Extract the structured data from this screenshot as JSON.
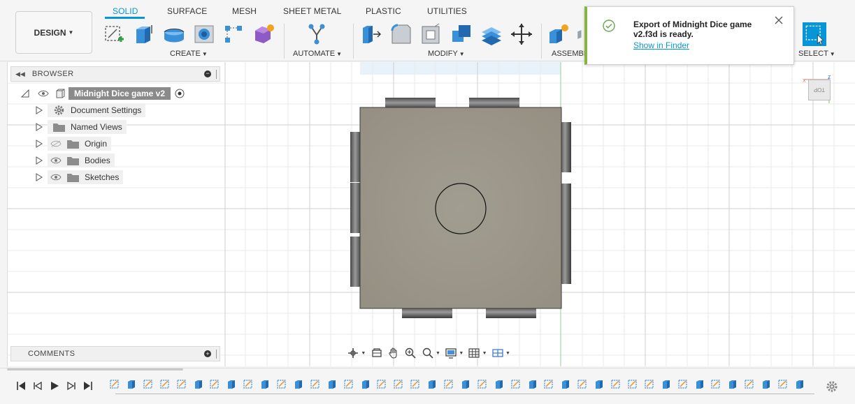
{
  "workspace": {
    "label": "DESIGN"
  },
  "tabs": [
    {
      "label": "SOLID",
      "active": true
    },
    {
      "label": "SURFACE",
      "active": false
    },
    {
      "label": "MESH",
      "active": false
    },
    {
      "label": "SHEET METAL",
      "active": false
    },
    {
      "label": "PLASTIC",
      "active": false
    },
    {
      "label": "UTILITIES",
      "active": false
    }
  ],
  "groups": {
    "create": "CREATE",
    "automate": "AUTOMATE",
    "modify": "MODIFY",
    "assemble": "ASSEMBL",
    "select": "SELECT"
  },
  "icons": {
    "create": [
      "create-sketch-icon",
      "extrude-icon",
      "revolve-icon",
      "hole-icon",
      "pattern-icon",
      "form-icon"
    ],
    "automate": [
      "automate-icon"
    ],
    "modify": [
      "press-pull-icon",
      "fillet-icon",
      "shell-icon",
      "combine-icon",
      "offset-face-icon",
      "move-icon"
    ],
    "assemble": [
      "new-component-icon"
    ],
    "select": "select-icon"
  },
  "browser": {
    "title": "BROWSER",
    "root": "Midnight Dice game v2",
    "items": [
      {
        "label": "Document Settings",
        "icon": "gear-icon"
      },
      {
        "label": "Named Views",
        "icon": "folder-icon"
      },
      {
        "label": "Origin",
        "icon": "folder-icon",
        "visible": false
      },
      {
        "label": "Bodies",
        "icon": "folder-icon",
        "visible": true
      },
      {
        "label": "Sketches",
        "icon": "folder-icon",
        "visible": true
      }
    ]
  },
  "comments": {
    "title": "COMMENTS"
  },
  "viewcube": {
    "face": "TOP",
    "axis_x": "X",
    "axis_z": "Z"
  },
  "notification": {
    "message": "Export of Midnight Dice game v2.f3d is ready.",
    "link": "Show in Finder"
  },
  "timeline": {
    "controls": [
      "skip-to-start",
      "step-back",
      "play",
      "step-forward",
      "skip-to-end"
    ],
    "feature_count": 42
  },
  "colors": {
    "accent": "#0696d7",
    "body_face": "#9b9689",
    "body_edge": "#3a3a3a",
    "toast_ok": "#87b340"
  }
}
